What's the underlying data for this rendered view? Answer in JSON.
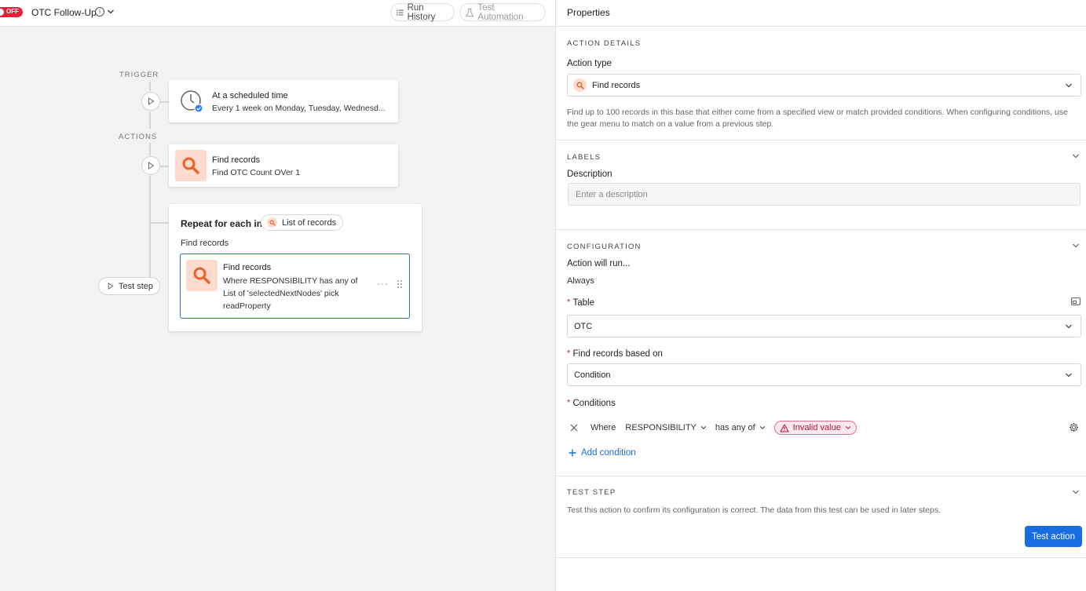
{
  "header": {
    "toggle_state": "OFF",
    "automation_title": "OTC Follow-Up",
    "run_history_label": "Run History",
    "test_automation_label": "Test Automation"
  },
  "canvas": {
    "trigger_section": "TRIGGER",
    "actions_section": "ACTIONS",
    "trigger_card": {
      "title": "At a scheduled time",
      "subtitle": "Every 1 week on Monday, Tuesday, Wednesd..."
    },
    "action_card": {
      "title": "Find records",
      "subtitle": "Find OTC Count OVer 1"
    },
    "repeat_card": {
      "title": "Repeat for each in",
      "list_pill": "List of records",
      "subtitle": "Find records",
      "inner_title": "Find records",
      "inner_desc": "Where RESPONSIBILITY has any of List of 'selectedNextNodes' pick readProperty"
    },
    "test_step_label": "Test step"
  },
  "panel": {
    "title": "Properties",
    "action_details": {
      "section": "ACTION DETAILS",
      "action_type_label": "Action type",
      "action_type_value": "Find records",
      "description": "Find up to 100 records in this base that either come from a specified view or match provided conditions. When configuring conditions, use the gear menu to match on a value from a previous step."
    },
    "labels": {
      "section": "LABELS",
      "description_label": "Description",
      "description_placeholder": "Enter a description"
    },
    "configuration": {
      "section": "CONFIGURATION",
      "run_label": "Action will run...",
      "run_value": "Always",
      "table_label": "Table",
      "table_value": "OTC",
      "based_on_label": "Find records based on",
      "based_on_value": "Condition",
      "conditions_label": "Conditions",
      "condition": {
        "where": "Where",
        "field": "RESPONSIBILITY",
        "operator": "has any of",
        "value": "Invalid value"
      },
      "add_condition_label": "Add condition"
    },
    "test_step": {
      "section": "TEST STEP",
      "description": "Test this action to confirm its configuration is correct. The data from this test can be used in later steps.",
      "button_label": "Test action"
    }
  },
  "colors": {
    "accent_blue": "#176ee0",
    "off_red": "#e5203a",
    "search_tile_bg": "#fedbcf",
    "search_orange": "#f0602a",
    "invalid_pink": "#b0163d"
  }
}
